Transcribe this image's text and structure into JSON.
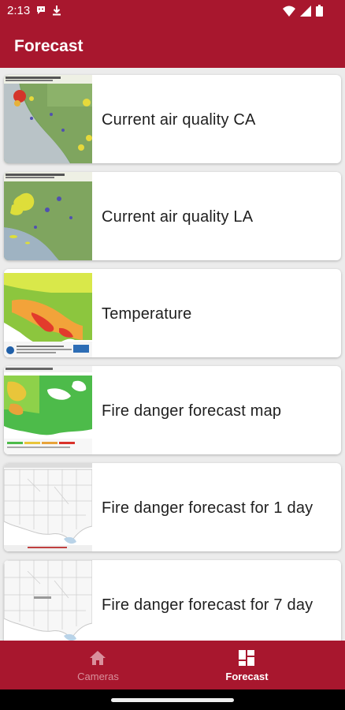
{
  "status_bar": {
    "time": "2:13",
    "left_icons": [
      "chat-notification-icon",
      "download-icon"
    ],
    "right_icons": [
      "wifi-icon",
      "signal-icon",
      "battery-icon"
    ]
  },
  "app_bar": {
    "title": "Forecast"
  },
  "forecast_list": [
    {
      "label": "Current air quality CA",
      "thumbnail": "california-air-quality-map"
    },
    {
      "label": "Current air quality LA",
      "thumbnail": "los-angeles-air-quality-map"
    },
    {
      "label": "Temperature",
      "thumbnail": "temperature-map"
    },
    {
      "label": "Fire danger forecast map",
      "thumbnail": "fire-danger-map"
    },
    {
      "label": "Fire danger forecast for 1 day",
      "thumbnail": "us-outline-map"
    },
    {
      "label": "Fire danger forecast for 7 day",
      "thumbnail": "us-outline-map"
    }
  ],
  "bottom_nav": {
    "items": [
      {
        "label": "Cameras",
        "icon": "home-icon",
        "selected": false
      },
      {
        "label": "Forecast",
        "icon": "dashboard-icon",
        "selected": true
      }
    ]
  },
  "colors": {
    "brand": "#a8172e",
    "nav_inactive": "#d9909c",
    "card_background": "#ffffff",
    "list_background": "#ececec"
  }
}
